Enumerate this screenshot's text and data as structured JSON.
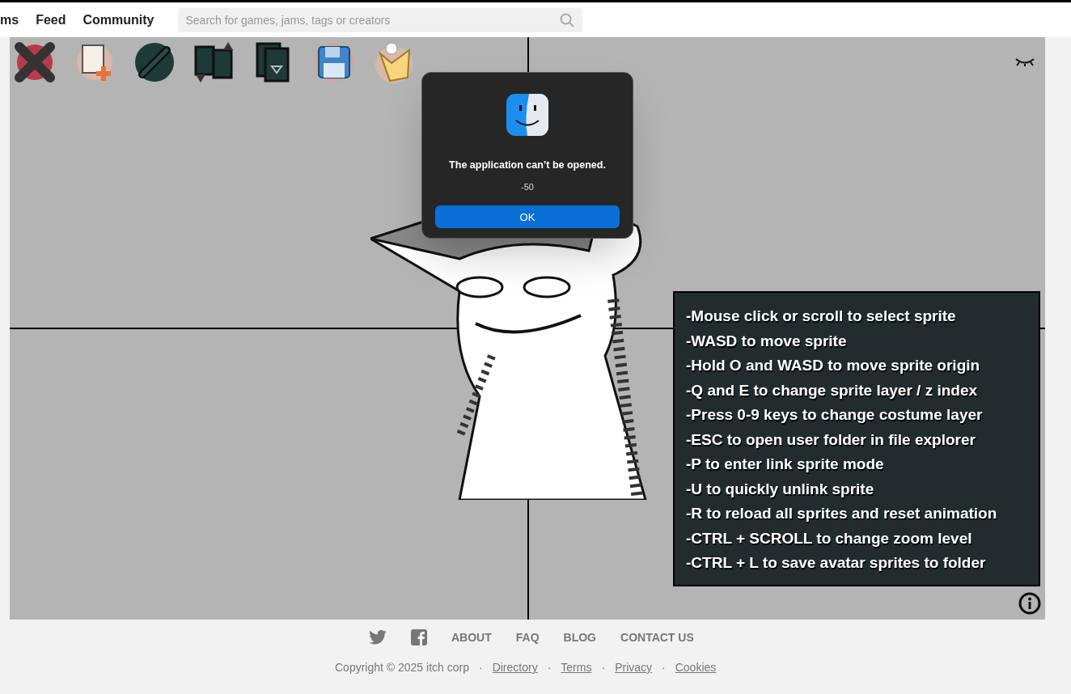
{
  "header": {
    "nav": [
      "ms",
      "Feed",
      "Community"
    ],
    "search": {
      "placeholder": "Search for games, jams, tags or creators"
    }
  },
  "dialog": {
    "message": "The application can’t be opened.",
    "code": "-50",
    "button": "OK"
  },
  "instructions": [
    "-Mouse click or scroll to select sprite",
    "-WASD to move sprite",
    "-Hold O and WASD to move sprite origin",
    "-Q and E to change sprite layer / z index",
    "-Press 0-9 keys to change costume layer",
    "-ESC to open user folder in file explorer",
    "-P to enter link sprite mode",
    "-U to quickly unlink sprite",
    "-R to reload all sprites and reset animation",
    "-CTRL + SCROLL to change zoom level",
    "-CTRL + L to save avatar sprites to folder"
  ],
  "footer": {
    "links": [
      "ABOUT",
      "FAQ",
      "BLOG",
      "CONTACT US"
    ],
    "copyright": "Copyright © 2025 itch corp",
    "separator": "·",
    "legal_links": [
      "Directory",
      "Terms",
      "Privacy",
      "Cookies"
    ]
  }
}
